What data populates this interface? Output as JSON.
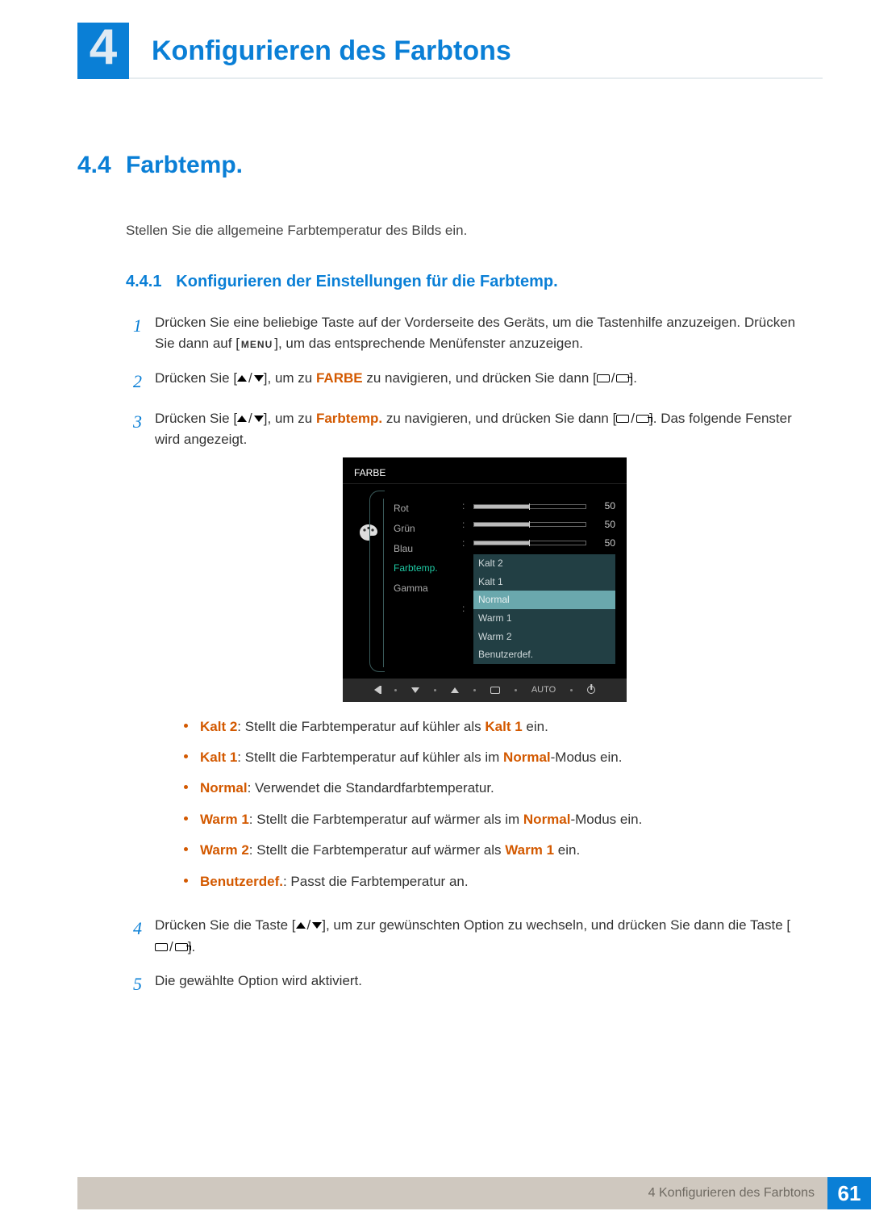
{
  "chapter": {
    "number": "4",
    "title": "Konfigurieren des Farbtons"
  },
  "section": {
    "number": "4.4",
    "title": "Farbtemp."
  },
  "intro": "Stellen Sie die allgemeine Farbtemperatur des Bilds ein.",
  "subsection": {
    "number": "4.4.1",
    "title": "Konfigurieren der Einstellungen für die Farbtemp."
  },
  "menu_label": "MENU",
  "terms": {
    "farbe": "FARBE",
    "farbtemp": "Farbtemp.",
    "kalt2": "Kalt 2",
    "kalt1": "Kalt 1",
    "normal": "Normal",
    "warm1": "Warm 1",
    "warm2": "Warm 2",
    "benutzer": "Benutzerdef."
  },
  "steps": {
    "s1a": "Drücken Sie eine beliebige Taste auf der Vorderseite des Geräts, um die Tastenhilfe anzuzeigen. Drücken Sie dann auf [",
    "s1b": "], um das entsprechende Menüfenster anzuzeigen.",
    "s2a": "Drücken Sie [",
    "s2b": "], um zu ",
    "s2c": " zu navigieren, und drücken Sie dann [",
    "s2d": "].",
    "s3a": "Drücken Sie [",
    "s3b": "], um zu ",
    "s3c": " zu navigieren, und drücken Sie dann [",
    "s3d": "]. Das folgende Fenster wird angezeigt.",
    "s4a": "Drücken Sie die Taste [",
    "s4b": "], um zur gewünschten Option zu wechseln, und drücken Sie dann die Taste [",
    "s4c": "].",
    "s5": "Die gewählte Option wird aktiviert."
  },
  "bullets": {
    "b1a": ": Stellt die Farbtemperatur auf kühler als ",
    "b1b": " ein.",
    "b2a": ": Stellt die Farbtemperatur auf kühler als im ",
    "b2b": "-Modus ein.",
    "b3": ": Verwendet die Standardfarbtemperatur.",
    "b4a": ": Stellt die Farbtemperatur auf wärmer als im ",
    "b4b": "-Modus ein.",
    "b5a": ": Stellt die Farbtemperatur auf wärmer als ",
    "b5b": " ein.",
    "b6": ": Passt die Farbtemperatur an."
  },
  "osd": {
    "title": "FARBE",
    "rows": {
      "rot": "Rot",
      "gruen": "Grün",
      "blau": "Blau",
      "farbtemp": "Farbtemp.",
      "gamma": "Gamma"
    },
    "value": "50",
    "options": {
      "kalt2": "Kalt 2",
      "kalt1": "Kalt 1",
      "normal": "Normal",
      "warm1": "Warm 1",
      "warm2": "Warm 2",
      "benutzer": "Benutzerdef."
    },
    "auto": "AUTO"
  },
  "footer": {
    "text": "4 Konfigurieren des Farbtons",
    "page": "61"
  }
}
